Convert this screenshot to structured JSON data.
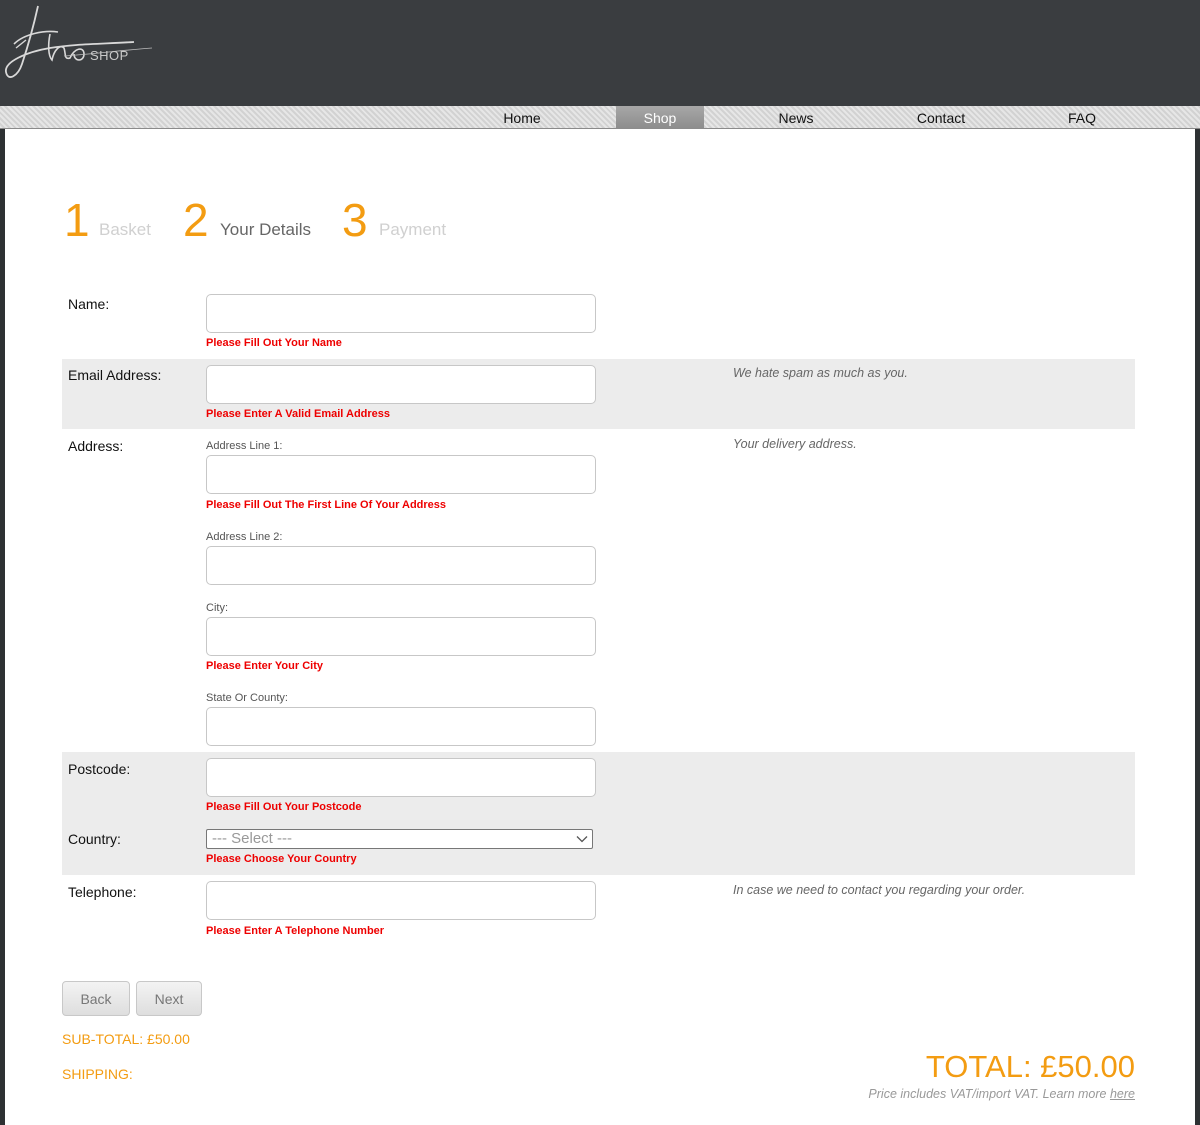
{
  "brand": {
    "logo_script": "Eno",
    "logo_suffix": "SHOP"
  },
  "nav": {
    "items": [
      {
        "label": "Home"
      },
      {
        "label": "Shop",
        "active": true
      },
      {
        "label": "News"
      },
      {
        "label": "Contact"
      },
      {
        "label": "FAQ"
      }
    ]
  },
  "steps": [
    {
      "number": "1",
      "label": "Basket"
    },
    {
      "number": "2",
      "label": "Your Details",
      "current": true
    },
    {
      "number": "3",
      "label": "Payment"
    }
  ],
  "form": {
    "name": {
      "label": "Name:",
      "value": "",
      "error": "Please Fill Out Your Name"
    },
    "email": {
      "label": "Email Address:",
      "value": "",
      "error": "Please Enter A Valid Email Address",
      "hint": "We hate spam as much as you."
    },
    "address": {
      "label": "Address:",
      "hint": "Your delivery address.",
      "line1": {
        "label": "Address Line 1:",
        "value": "",
        "error": "Please Fill Out The First Line Of Your Address"
      },
      "line2": {
        "label": "Address Line 2:",
        "value": ""
      },
      "city": {
        "label": "City:",
        "value": "",
        "error": "Please Enter Your City"
      },
      "state": {
        "label": "State Or County:",
        "value": ""
      }
    },
    "postcode": {
      "label": "Postcode:",
      "value": "",
      "error": "Please Fill Out Your Postcode"
    },
    "country": {
      "label": "Country:",
      "selected": "--- Select ---",
      "error": "Please Choose Your Country"
    },
    "telephone": {
      "label": "Telephone:",
      "value": "",
      "error": "Please Enter A Telephone Number",
      "hint": "In case we need to contact you regarding your order."
    }
  },
  "buttons": {
    "back": "Back",
    "next": "Next"
  },
  "summary": {
    "subtotal": "SUB-TOTAL: £50.00",
    "shipping": "SHIPPING:",
    "total": "TOTAL: £50.00",
    "vat_note": "Price includes VAT/import VAT. Learn more ",
    "vat_link": "here"
  },
  "colors": {
    "accent": "#f39c12",
    "error": "#ee0000",
    "header": "#3a3d40"
  }
}
